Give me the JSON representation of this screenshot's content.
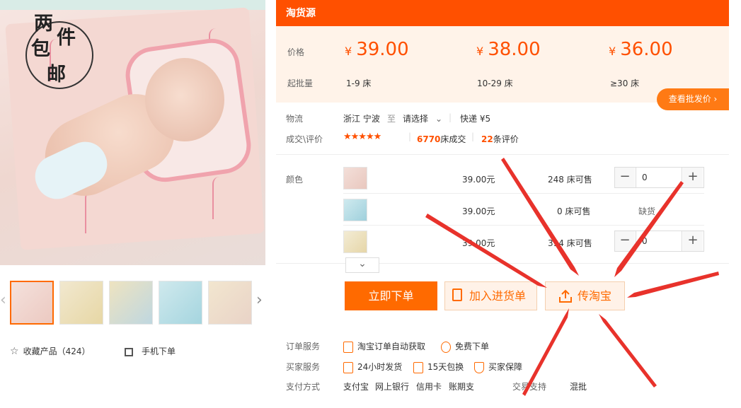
{
  "badge": {
    "chars": [
      "两",
      "件",
      "包",
      "邮"
    ]
  },
  "gallery": {
    "thumb_count": 5,
    "next_arrow_glyph": "›"
  },
  "actions_left": {
    "favorite_label": "收藏产品（424）",
    "mobile_label": "手机下单"
  },
  "header": {
    "title": "淘货源"
  },
  "prices": {
    "price_label": "价格",
    "moq_label": "起批量",
    "currency": "¥",
    "tiers": [
      {
        "price": "39.00",
        "range": "1-9 床"
      },
      {
        "price": "38.00",
        "range": "10-29 床"
      },
      {
        "price": "36.00",
        "range": "≥30 床"
      }
    ],
    "batch_button": "查看批发价 ›"
  },
  "logistics": {
    "label": "物流",
    "origin": "浙江 宁波",
    "to": "至",
    "select": "请选择",
    "express": "快递 ¥5"
  },
  "reviews": {
    "label": "成交\\评价",
    "stars": "★★★★★",
    "deals_count": "6770",
    "deals_text": "床成交",
    "review_count": "22",
    "review_text": "条评价"
  },
  "sku": {
    "label": "颜色",
    "rows": [
      {
        "price": "39.00元",
        "stock": "248 床可售",
        "qty": "0",
        "status": ""
      },
      {
        "price": "39.00元",
        "stock": "0 床可售",
        "qty": "",
        "status": "缺货"
      },
      {
        "price": "39.00元",
        "stock": "394 床可售",
        "qty": "0",
        "status": ""
      }
    ],
    "minus": "−",
    "plus": "+",
    "expand_glyph": "⌄"
  },
  "buttons": {
    "buy": "立即下单",
    "cart": "加入进货单",
    "upload": "传淘宝"
  },
  "services": {
    "order_label": "订单服务",
    "order_items": [
      "淘宝订单自动获取",
      "免费下单"
    ],
    "buyer_label": "买家服务",
    "buyer_items": [
      "24小时发货",
      "15天包换",
      "买家保障"
    ],
    "pay_label": "支付方式",
    "pay_items": [
      "支付宝",
      "网上银行",
      "信用卡",
      "账期支"
    ],
    "trade_label": "交易支持",
    "trade_value": "混批"
  },
  "colors": {
    "accent": "#ff5000",
    "button": "#ff6a00",
    "arrow": "#e8322b"
  }
}
